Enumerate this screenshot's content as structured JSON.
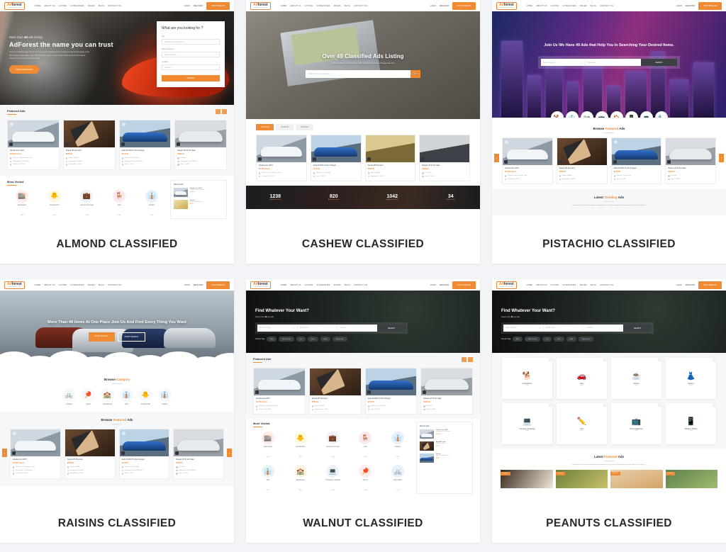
{
  "page": {
    "background": "#f2f4f7",
    "accent": "#f08b33"
  },
  "nav": {
    "logo_main": "Ad",
    "logo_rest": "forest",
    "logo_sub": "CLASSIFIED ADS",
    "links": [
      "HOME",
      "ABOUT US",
      "LISTING",
      "CATEGORIES",
      "PAGES",
      "BLOG",
      "CONTACT US"
    ],
    "login": "LOGIN",
    "register": "REGISTER",
    "post_ad": "POST FREE AD"
  },
  "demos": [
    {
      "title": "ALMOND CLASSIFIED",
      "hero": {
        "eyebrow_pre": "More than",
        "eyebrow_num": "49",
        "eyebrow_post": "ads listing",
        "headline": "AdForest the name you can trust",
        "paragraph": "There is a leading page theme. We focus on the simplest way to build your ads posting page. Real Best Version page tailor-made defined better usages. Lorem ipsum dolor sit amet consectetur adipiscing elit sed do eiusmod tempor.",
        "cta": "VIEW MORE ADS"
      },
      "search_panel": {
        "title": "What are you looking for ?",
        "label_title": "Title",
        "placeholder_title": "What are you looking for?...",
        "label_category": "Select Category",
        "placeholder_category": "Select Location",
        "label_location": "Location",
        "placeholder_location": "Location",
        "button": "SEARCH"
      },
      "featured": {
        "heading": "Featured Ads"
      },
      "most_visited": {
        "heading": "Most Visited"
      },
      "recent": {
        "heading": "Recent Ads"
      }
    },
    {
      "title": "CASHEW CLASSIFIED",
      "hero": {
        "headline_pre": "Over",
        "headline_num": "49",
        "headline_post": "Classified Ads Listing",
        "subtitle": "Find everything you need in one place. Browse thousands of listings near you.",
        "search_placeholder": "What Are You Looking For..."
      },
      "tabs": [
        "POPULAR",
        "RANDOM",
        "NEAR ME"
      ],
      "stats": [
        {
          "number": "1238",
          "label_pre": "Total",
          "label_accent": "Ads Posted"
        },
        {
          "number": "820",
          "label_pre": "Active",
          "label_accent": "Members"
        },
        {
          "number": "1042",
          "label_pre": "Happy",
          "label_accent": "Customers"
        },
        {
          "number": "34",
          "label_pre": "Daily",
          "label_accent": "Visitors"
        }
      ]
    },
    {
      "title": "PISTACHIO CLASSIFIED",
      "hero": {
        "headline_a": "Join Us We Have",
        "headline_num": "49",
        "headline_b": "Ads that Help You",
        "headline_c": "In Searching",
        "headline_d": "Your Desired Items.",
        "select_placeholder": "Select Category",
        "keyword_placeholder": "Keywords...",
        "button": "SEARCH"
      },
      "featured": {
        "pre": "Browse",
        "accent": "Featured",
        "post": "Ads"
      },
      "trending": {
        "pre": "Latest",
        "accent": "Trending",
        "post": "Ads",
        "desc": "Excepteur sint occaecat cupidatat non proident sunt in culpa qui officia deserunt mollit anim id est laborum."
      }
    },
    {
      "title": "RAISINS CLASSIFIED",
      "hero": {
        "headline_a": "More Than",
        "headline_num": "49",
        "headline_b": "Items At",
        "headline_c": "One Place",
        "headline_d": "Join Us And Find Every Thing You Want",
        "btn_primary": "POST FREE AD",
        "btn_secondary": "START SEARCH"
      },
      "browse": {
        "pre": "Browse",
        "accent": "Category"
      },
      "categories": [
        {
          "name": "Vehicles",
          "icon": "🚲"
        },
        {
          "name": "Sports",
          "icon": "🏓"
        },
        {
          "name": "Educational",
          "icon": "🏫"
        },
        {
          "name": "Jobs",
          "icon": "👔"
        },
        {
          "name": "Animals Pets",
          "icon": "🐥"
        },
        {
          "name": "Fashion",
          "icon": "👔"
        }
      ],
      "featured": {
        "pre": "Browse",
        "accent": "Featured",
        "post": "Ads"
      }
    },
    {
      "title": "WALNUT CLASSIFIED",
      "hero": {
        "headline": "Find Whatever Your Want?",
        "sub_pre": "Search from",
        "sub_num": "49",
        "sub_post": "new ads",
        "select_placeholder": "Select Category",
        "keyword_placeholder": "Search Here...",
        "location_placeholder": "Location...",
        "button": "SEARCH"
      },
      "tags_label": "Popular Tags",
      "tags": [
        "Bike",
        "Bike for sale",
        "Car",
        "Flats",
        "Audi",
        "House Sale"
      ],
      "featured": {
        "heading": "Featured Ads"
      },
      "most_visited": {
        "heading": "Most Visited"
      },
      "recent": {
        "heading": "Recent Ads"
      }
    },
    {
      "title": "PEANUTS CLASSIFIED",
      "hero": {
        "headline": "Find Whatever Your Want?",
        "sub_pre": "Search from",
        "sub_num": "49",
        "sub_post": "new ads",
        "select_placeholder": "Select Category",
        "keyword_placeholder": "Search Here...",
        "location_placeholder": "Location...",
        "button": "SEARCH"
      },
      "tags_label": "Popular Tags",
      "tags": [
        "Bike",
        "Bike for sale",
        "Car",
        "Flats",
        "Audi",
        "House Sale"
      ],
      "categories": [
        {
          "name": "Animals/Pets",
          "count": "4 Ads",
          "icon": "🐕"
        },
        {
          "name": "Cars",
          "count": "8 Ads",
          "icon": "🚗"
        },
        {
          "name": "Kitchen",
          "count": "3 Ads",
          "icon": "☕"
        },
        {
          "name": "Fashion",
          "count": "5 Ads",
          "icon": "👗"
        },
        {
          "name": "Computer & Laptops",
          "count": "6 Ads",
          "icon": "💻"
        },
        {
          "name": "Jobs",
          "count": "2 Ads",
          "icon": "✏️"
        },
        {
          "name": "Home Appliances",
          "count": "4 Ads",
          "icon": "📺"
        },
        {
          "name": "Mobile & Tablets",
          "count": "7 Ads",
          "icon": "📱"
        }
      ],
      "latest": {
        "pre": "Latest",
        "accent": "Featured",
        "post": "Ads",
        "desc": "Excepteur sint occaecat cupidatat non proident sunt in culpa qui officia deserunt mollit anim id est laborum."
      }
    }
  ],
  "ads": [
    {
      "title": "Honda civic 2007",
      "price": "$4,500 Fixed",
      "meta": [
        "Vehicles, Cars, Honda, Cars",
        "Islamabad, G-11 Markaz",
        "October 23, 2019"
      ],
      "thumb": "img-car-white"
    },
    {
      "title": "Xperia Z5 Premium",
      "price": "$580.00",
      "meta": [
        "Sports, Mobile",
        "Rawalpindi, Saddar",
        "September 2, 2019"
      ],
      "thumb": "img-phones"
    },
    {
      "title": "Audi A6 With Turbo Charger",
      "price": "$170.00",
      "meta": [
        "Vehicles, Car, Honda",
        "Sheikhupura, G-11 Markaz",
        "June 1, 2019"
      ],
      "thumb": "img-car-blue"
    },
    {
      "title": "Nissan GT-R For Sale",
      "price": "$280.00",
      "meta": [
        "For Sale",
        "Islamabad, G-11 Markaz",
        "June 1, 2019"
      ],
      "thumb": "img-car-gtr"
    }
  ],
  "most_visited_items": [
    {
      "name": "Real Estate",
      "count": "3 Ads",
      "icon": "🏬",
      "bg": "#fdecea"
    },
    {
      "name": "Animals Pets",
      "count": "4 Ads",
      "icon": "🐥",
      "bg": "#fff8e1"
    },
    {
      "name": "Games & Console",
      "count": "2 Ads",
      "icon": "💼",
      "bg": "#eef1f5"
    },
    {
      "name": "Cars",
      "count": "8 Ads",
      "icon": "🪑",
      "bg": "#fce8f1"
    },
    {
      "name": "Fashion",
      "count": "5 Ads",
      "icon": "👔",
      "bg": "#e8f1fb"
    }
  ],
  "most_visited_items2": [
    {
      "name": "Real Estate",
      "count": "3 Ads",
      "icon": "🏬",
      "bg": "#fdecea"
    },
    {
      "name": "Animals Pets",
      "count": "4 Ads",
      "icon": "🐥",
      "bg": "#fff8e1"
    },
    {
      "name": "Games & Console",
      "count": "2 Ads",
      "icon": "💼",
      "bg": "#eef1f5"
    },
    {
      "name": "Cars",
      "count": "8 Ads",
      "icon": "🪑",
      "bg": "#fce8f1"
    },
    {
      "name": "Fashion",
      "count": "5 Ads",
      "icon": "👔",
      "bg": "#e8f1fb"
    },
    {
      "name": "Jobs",
      "count": "2 Ads",
      "icon": "👔",
      "bg": "#eaf6ec"
    },
    {
      "name": "Educational",
      "count": "3 Ads",
      "icon": "🏫",
      "bg": "#fff4e3"
    },
    {
      "name": "Computer & Laptops",
      "count": "6 Ads",
      "icon": "💻",
      "bg": "#eef1f5"
    },
    {
      "name": "Sports",
      "count": "2 Ads",
      "icon": "🏓",
      "bg": "#fdecea"
    },
    {
      "name": "More Bikes",
      "count": "1 Ad",
      "icon": "🚲",
      "bg": "#e8f1fb"
    }
  ],
  "recent_items": [
    {
      "title": "Honda civic 2007",
      "meta": "Islamabad, G-11 Markaz",
      "price": "$4,500"
    },
    {
      "title": "Nissan",
      "meta": "Lahore, DHA Phase 5",
      "price": "$280"
    },
    {
      "title": "Audi A6 Turbo",
      "meta": "Karachi, Clifton",
      "price": "$170"
    }
  ],
  "pager": {
    "prev": "‹",
    "next": "›"
  },
  "search_icon": "🔍"
}
